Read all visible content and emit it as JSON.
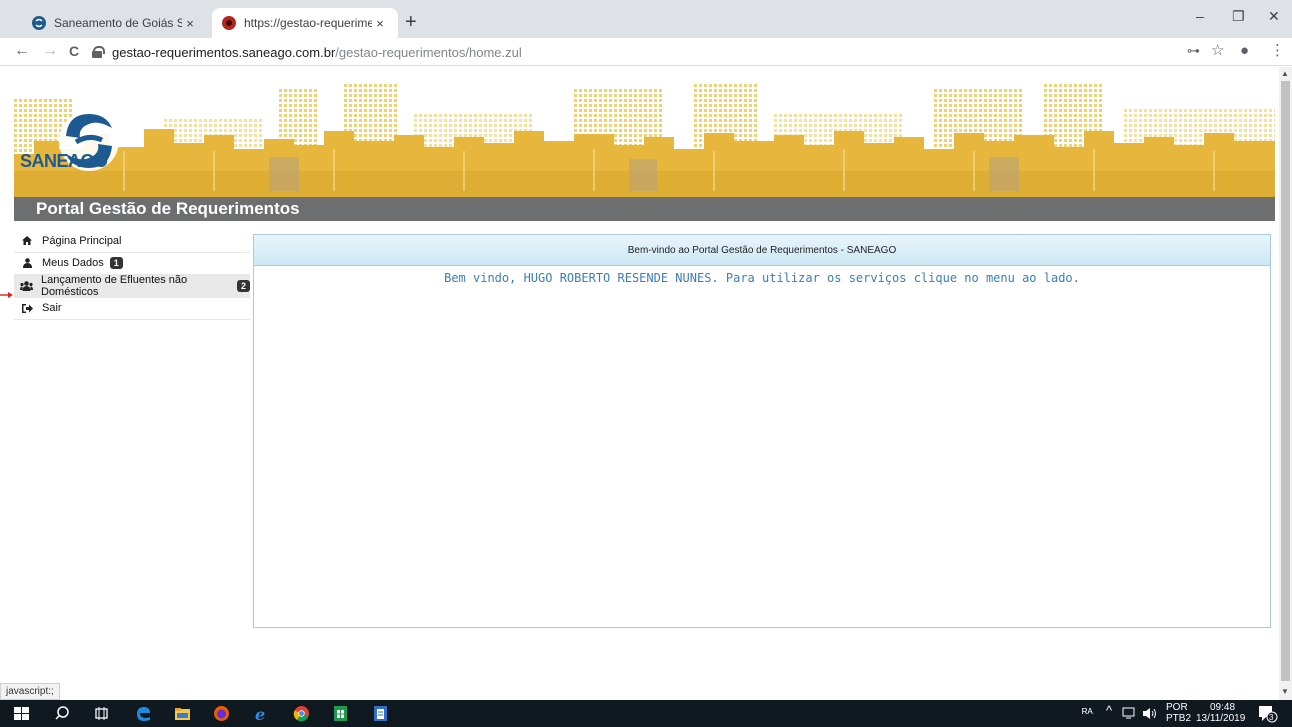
{
  "browser": {
    "tabs": [
      {
        "title": "Saneamento de Goiás S.A",
        "active": false
      },
      {
        "title": "https://gestao-requerimentos.sa",
        "active": true
      }
    ],
    "close_glyph": "×",
    "new_tab_glyph": "+",
    "window_controls": [
      "–",
      "❐",
      "✕"
    ],
    "url_domain": "gestao-requerimentos.saneago.com.br",
    "url_path": "/gestao-requerimentos/home.zul",
    "nav": {
      "back": "←",
      "forward": "→",
      "reload": "C"
    },
    "omni_icons": {
      "key": "⊶",
      "star": "☆",
      "profile": "●",
      "menu": "⋮"
    }
  },
  "site": {
    "logo_text": "SANEAGO",
    "portal_title": "Portal Gestão de Requerimentos"
  },
  "sidebar": {
    "items": [
      {
        "label": "Página Principal",
        "icon": "home-icon",
        "badge": ""
      },
      {
        "label": "Meus Dados",
        "icon": "user-icon",
        "badge": "1"
      },
      {
        "label": "Lançamento de Efluentes não Domésticos",
        "icon": "users-icon",
        "badge": "2"
      },
      {
        "label": "Sair",
        "icon": "sign-out-icon",
        "badge": ""
      }
    ]
  },
  "panel": {
    "header": "Bem-vindo ao Portal Gestão de Requerimentos - SANEAGO",
    "welcome": "Bem vindo, HUGO ROBERTO RESENDE NUNES. Para utilizar os serviços clique no menu ao lado."
  },
  "status_bar": "javascript:;",
  "taskbar": {
    "lang_top": "POR",
    "lang_bottom": "PTB2",
    "time": "09:48",
    "date": "13/11/2019",
    "notification_count": "3"
  },
  "colors": {
    "banner_gold": "#e6b73c",
    "banner_gold_light": "#f3d88a",
    "portal_bar": "#6d6e70",
    "logo_blue": "#1d5a91",
    "welcome_text": "#3b7dbf",
    "panel_border": "#a8cbe0"
  }
}
